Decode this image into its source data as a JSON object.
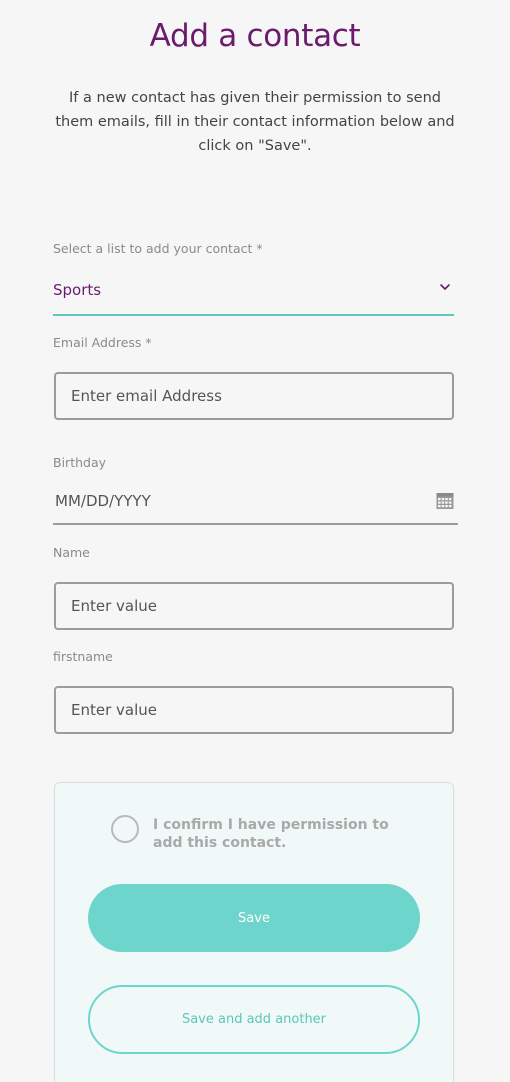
{
  "page": {
    "title": "Add a contact",
    "intro": "If a new contact has given their permission to send them emails, fill in their contact information below and click on \"Save\"."
  },
  "list_select": {
    "label": "Select a list to add your contact *",
    "value": "Sports",
    "icon": "chevron-down-icon"
  },
  "email": {
    "label": "Email Address *",
    "placeholder": "Enter email Address"
  },
  "birthday": {
    "label": "Birthday",
    "placeholder": "MM/DD/YYYY",
    "icon": "calendar-icon"
  },
  "name": {
    "label": "Name",
    "placeholder": "Enter value"
  },
  "firstname": {
    "label": "firstname",
    "placeholder": "Enter value"
  },
  "consent": {
    "text": "I confirm I have permission to add this contact.",
    "checked": false
  },
  "buttons": {
    "save": "Save",
    "save_another": "Save and add another"
  },
  "colors": {
    "title": "#6b1a6e",
    "accent": "#6dd5cb",
    "underline": "#5fc6c0"
  }
}
